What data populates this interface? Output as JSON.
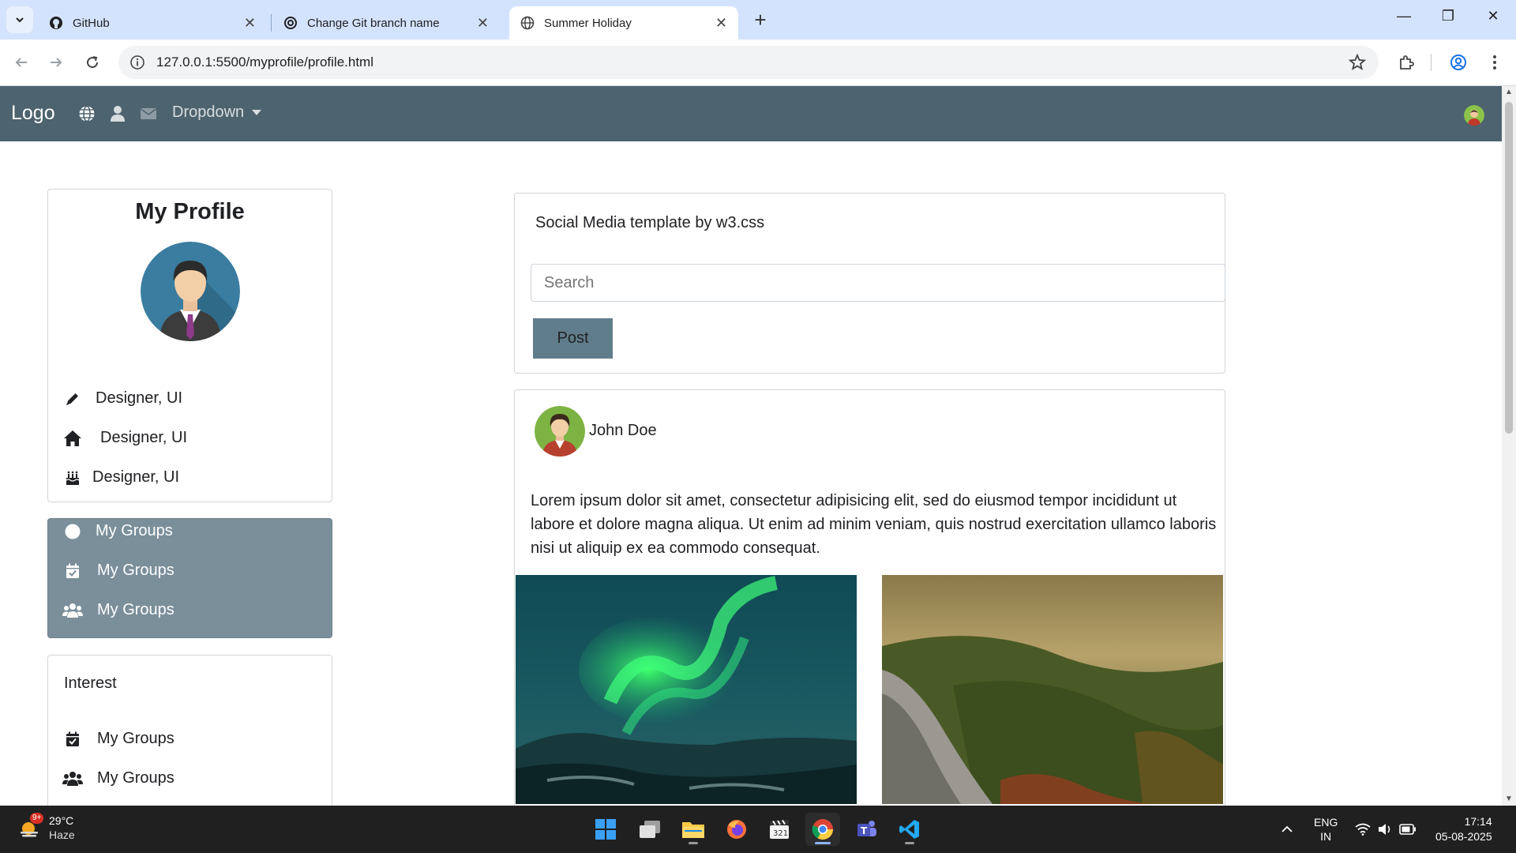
{
  "browser": {
    "tabs": [
      {
        "title": "GitHub",
        "icon": "github-icon",
        "active": false
      },
      {
        "title": "Change Git branch name",
        "icon": "chatgpt-icon",
        "active": false
      },
      {
        "title": "Summer Holiday",
        "icon": "globe-icon",
        "active": true
      }
    ],
    "url": "127.0.0.1:5500/myprofile/profile.html"
  },
  "topnav": {
    "logo": "Logo",
    "dropdown_label": "Dropdown",
    "icons": [
      "globe-icon",
      "user-icon",
      "envelope-icon"
    ]
  },
  "profile": {
    "title": "My Profile",
    "rows": [
      {
        "icon": "pencil-icon",
        "label": "Designer, UI"
      },
      {
        "icon": "home-icon",
        "label": "Designer, UI"
      },
      {
        "icon": "birthday-cake-icon",
        "label": "Designer, UI"
      }
    ]
  },
  "groups": {
    "rows": [
      {
        "icon": "circle-icon",
        "label": "My Groups"
      },
      {
        "icon": "calendar-check-icon",
        "label": "My Groups"
      },
      {
        "icon": "users-icon",
        "label": "My Groups"
      }
    ]
  },
  "interest": {
    "heading": "Interest",
    "rows": [
      {
        "icon": "calendar-check-icon",
        "label": "My Groups"
      },
      {
        "icon": "users-icon",
        "label": "My Groups"
      }
    ]
  },
  "composer": {
    "caption": "Social Media template by w3.css",
    "search_placeholder": "Search",
    "post_label": "Post"
  },
  "feed": {
    "author": "John Doe",
    "text": "Lorem ipsum dolor sit amet, consectetur adipisicing elit, sed do eiusmod tempor incididunt ut labore et dolore magna aliqua. Ut enim ad minim veniam, quis nostrud exercitation ullamco laboris nisi ut aliquip ex ea commodo consequat.",
    "photos": [
      "northern-lights-photo",
      "forest-valley-photo"
    ]
  },
  "taskbar": {
    "weather_temp": "29°C",
    "weather_cond": "Haze",
    "weather_badge": "9+",
    "lang_top": "ENG",
    "lang_bottom": "IN",
    "time": "17:14",
    "date": "05-08-2025"
  },
  "colors": {
    "navbar": "#4d636f",
    "groups_bg": "#7a8f9a",
    "post_button": "#607d8b",
    "tabbar": "#d3e3fd"
  }
}
